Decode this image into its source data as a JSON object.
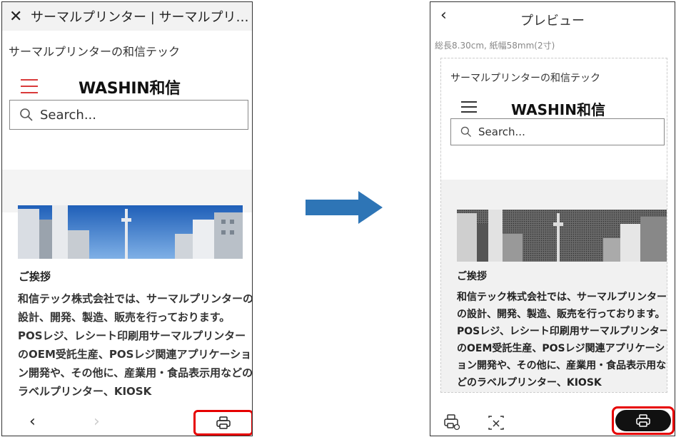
{
  "browser": {
    "close_icon": "close-icon",
    "title": "サーマルプリンター | サーマルプリ…"
  },
  "site": {
    "name": "サーマルプリンターの和信テック",
    "logo": "WASHIN和信",
    "search_placeholder": "Search...",
    "greeting": "ご挨拶",
    "body_text": "和信テック株式会社では、サーマルプリンターの設計、開発、製造、販売を行っております。POSレジ、レシート印刷用サーマルプリンターのOEM受託生産、POSレジ関連アプリケーション開発や、その他に、産業用・食品表示用などのラベルプリンター、KIOSK"
  },
  "browser_nav": {
    "back": "‹",
    "forward": "›",
    "print_icon": "printer-icon"
  },
  "preview": {
    "back": "‹",
    "title": "プレビュー",
    "paper_info": "総長8.30cm, 紙幅58mm(2寸)",
    "bottom": {
      "printer_settings_icon": "printer-settings-icon",
      "crop_icon": "crop-icon",
      "print_icon": "printer-icon"
    }
  },
  "colors": {
    "highlight": "#e60000",
    "arrow": "#2e75b6",
    "hamburger": "#d93a3a"
  }
}
